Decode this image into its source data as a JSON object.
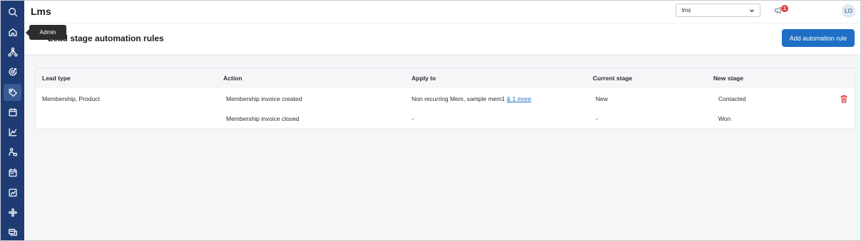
{
  "app": {
    "title": "Lms"
  },
  "sidebar": {
    "tooltip": "Admin",
    "items": [
      {
        "icon": "search-icon"
      },
      {
        "icon": "home-icon"
      },
      {
        "icon": "network-icon"
      },
      {
        "icon": "target-icon"
      },
      {
        "icon": "tag-icon",
        "active": true
      },
      {
        "icon": "calendar-icon"
      },
      {
        "icon": "chart-icon"
      },
      {
        "icon": "workflow-icon"
      },
      {
        "icon": "schedule-icon"
      },
      {
        "icon": "report-icon"
      },
      {
        "icon": "integrations-icon"
      },
      {
        "icon": "messages-icon"
      }
    ]
  },
  "topbar": {
    "select_value": "lms",
    "notification_count": "1",
    "avatar_initials": "LO"
  },
  "page": {
    "title": "Lead stage automation rules",
    "add_button": "Add automation rule"
  },
  "table": {
    "columns": [
      "Lead type",
      "Action",
      "Apply to",
      "Current stage",
      "New stage"
    ],
    "rows": [
      {
        "lead_type": "Membership, Product",
        "action": "Membership invoice created",
        "apply_to": "Non recurring Mem, sample mem1",
        "apply_to_more": "& 1 more",
        "current_stage": "New",
        "new_stage": "Contacted"
      },
      {
        "lead_type": "",
        "action": "Membership invoice closed",
        "apply_to": "-",
        "current_stage": "-",
        "new_stage": "Won"
      }
    ]
  },
  "colors": {
    "sidebar": "#1e3b73",
    "primary": "#1f6fc6",
    "danger": "#e23b3b"
  }
}
